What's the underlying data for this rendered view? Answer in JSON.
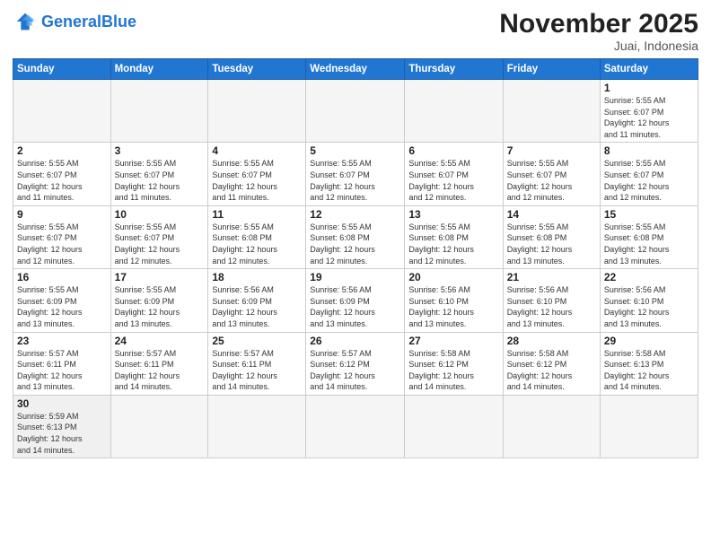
{
  "logo": {
    "text_general": "General",
    "text_blue": "Blue"
  },
  "header": {
    "month": "November 2025",
    "location": "Juai, Indonesia"
  },
  "weekdays": [
    "Sunday",
    "Monday",
    "Tuesday",
    "Wednesday",
    "Thursday",
    "Friday",
    "Saturday"
  ],
  "weeks": [
    [
      {
        "day": "",
        "info": ""
      },
      {
        "day": "",
        "info": ""
      },
      {
        "day": "",
        "info": ""
      },
      {
        "day": "",
        "info": ""
      },
      {
        "day": "",
        "info": ""
      },
      {
        "day": "",
        "info": ""
      },
      {
        "day": "1",
        "info": "Sunrise: 5:55 AM\nSunset: 6:07 PM\nDaylight: 12 hours\nand 11 minutes."
      }
    ],
    [
      {
        "day": "2",
        "info": "Sunrise: 5:55 AM\nSunset: 6:07 PM\nDaylight: 12 hours\nand 11 minutes."
      },
      {
        "day": "3",
        "info": "Sunrise: 5:55 AM\nSunset: 6:07 PM\nDaylight: 12 hours\nand 11 minutes."
      },
      {
        "day": "4",
        "info": "Sunrise: 5:55 AM\nSunset: 6:07 PM\nDaylight: 12 hours\nand 11 minutes."
      },
      {
        "day": "5",
        "info": "Sunrise: 5:55 AM\nSunset: 6:07 PM\nDaylight: 12 hours\nand 12 minutes."
      },
      {
        "day": "6",
        "info": "Sunrise: 5:55 AM\nSunset: 6:07 PM\nDaylight: 12 hours\nand 12 minutes."
      },
      {
        "day": "7",
        "info": "Sunrise: 5:55 AM\nSunset: 6:07 PM\nDaylight: 12 hours\nand 12 minutes."
      },
      {
        "day": "8",
        "info": "Sunrise: 5:55 AM\nSunset: 6:07 PM\nDaylight: 12 hours\nand 12 minutes."
      }
    ],
    [
      {
        "day": "9",
        "info": "Sunrise: 5:55 AM\nSunset: 6:07 PM\nDaylight: 12 hours\nand 12 minutes."
      },
      {
        "day": "10",
        "info": "Sunrise: 5:55 AM\nSunset: 6:07 PM\nDaylight: 12 hours\nand 12 minutes."
      },
      {
        "day": "11",
        "info": "Sunrise: 5:55 AM\nSunset: 6:08 PM\nDaylight: 12 hours\nand 12 minutes."
      },
      {
        "day": "12",
        "info": "Sunrise: 5:55 AM\nSunset: 6:08 PM\nDaylight: 12 hours\nand 12 minutes."
      },
      {
        "day": "13",
        "info": "Sunrise: 5:55 AM\nSunset: 6:08 PM\nDaylight: 12 hours\nand 12 minutes."
      },
      {
        "day": "14",
        "info": "Sunrise: 5:55 AM\nSunset: 6:08 PM\nDaylight: 12 hours\nand 13 minutes."
      },
      {
        "day": "15",
        "info": "Sunrise: 5:55 AM\nSunset: 6:08 PM\nDaylight: 12 hours\nand 13 minutes."
      }
    ],
    [
      {
        "day": "16",
        "info": "Sunrise: 5:55 AM\nSunset: 6:09 PM\nDaylight: 12 hours\nand 13 minutes."
      },
      {
        "day": "17",
        "info": "Sunrise: 5:55 AM\nSunset: 6:09 PM\nDaylight: 12 hours\nand 13 minutes."
      },
      {
        "day": "18",
        "info": "Sunrise: 5:56 AM\nSunset: 6:09 PM\nDaylight: 12 hours\nand 13 minutes."
      },
      {
        "day": "19",
        "info": "Sunrise: 5:56 AM\nSunset: 6:09 PM\nDaylight: 12 hours\nand 13 minutes."
      },
      {
        "day": "20",
        "info": "Sunrise: 5:56 AM\nSunset: 6:10 PM\nDaylight: 12 hours\nand 13 minutes."
      },
      {
        "day": "21",
        "info": "Sunrise: 5:56 AM\nSunset: 6:10 PM\nDaylight: 12 hours\nand 13 minutes."
      },
      {
        "day": "22",
        "info": "Sunrise: 5:56 AM\nSunset: 6:10 PM\nDaylight: 12 hours\nand 13 minutes."
      }
    ],
    [
      {
        "day": "23",
        "info": "Sunrise: 5:57 AM\nSunset: 6:11 PM\nDaylight: 12 hours\nand 13 minutes."
      },
      {
        "day": "24",
        "info": "Sunrise: 5:57 AM\nSunset: 6:11 PM\nDaylight: 12 hours\nand 14 minutes."
      },
      {
        "day": "25",
        "info": "Sunrise: 5:57 AM\nSunset: 6:11 PM\nDaylight: 12 hours\nand 14 minutes."
      },
      {
        "day": "26",
        "info": "Sunrise: 5:57 AM\nSunset: 6:12 PM\nDaylight: 12 hours\nand 14 minutes."
      },
      {
        "day": "27",
        "info": "Sunrise: 5:58 AM\nSunset: 6:12 PM\nDaylight: 12 hours\nand 14 minutes."
      },
      {
        "day": "28",
        "info": "Sunrise: 5:58 AM\nSunset: 6:12 PM\nDaylight: 12 hours\nand 14 minutes."
      },
      {
        "day": "29",
        "info": "Sunrise: 5:58 AM\nSunset: 6:13 PM\nDaylight: 12 hours\nand 14 minutes."
      }
    ],
    [
      {
        "day": "30",
        "info": "Sunrise: 5:59 AM\nSunset: 6:13 PM\nDaylight: 12 hours\nand 14 minutes."
      },
      {
        "day": "",
        "info": ""
      },
      {
        "day": "",
        "info": ""
      },
      {
        "day": "",
        "info": ""
      },
      {
        "day": "",
        "info": ""
      },
      {
        "day": "",
        "info": ""
      },
      {
        "day": "",
        "info": ""
      }
    ]
  ]
}
